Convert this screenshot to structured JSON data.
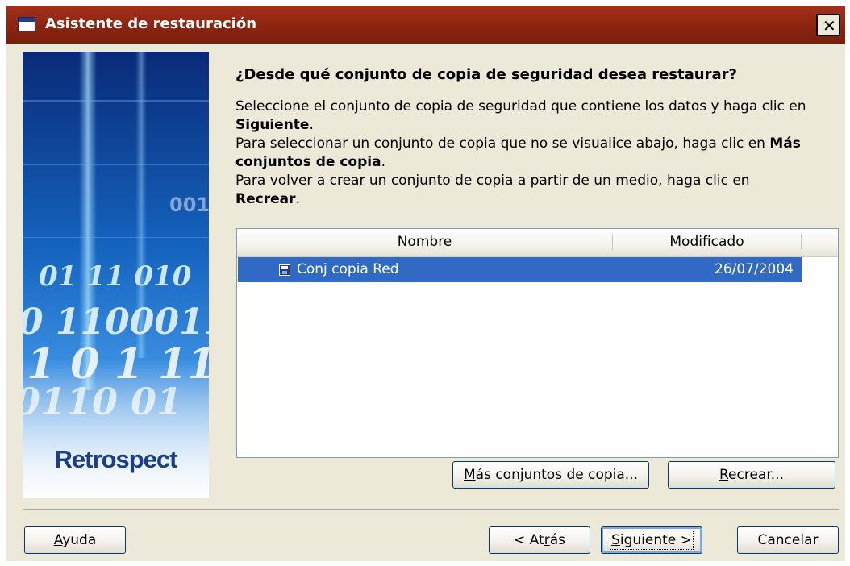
{
  "window": {
    "title": "Asistente de restauración",
    "close_symbol": "✕",
    "app_icon": "window-icon"
  },
  "side_panel": {
    "logo_text": "Retrospect",
    "image_description_icon": "binary-digits-image"
  },
  "content": {
    "heading": "¿Desde qué conjunto de copia de seguridad desea restaurar?",
    "p1_line1": "Seleccione el conjunto de copia de seguridad que contiene los datos y haga clic en",
    "p1_bold": "Siguiente",
    "p1_end": ".",
    "p2_line1_normal": "Para seleccionar un conjunto de copia que no se visualice abajo, haga clic en ",
    "p2_line1_bold": "Más",
    "p2_line2_bold": "conjuntos de copia",
    "p2_end": ".",
    "p3_line1": "Para volver a crear un conjunto de copia a partir de un medio, haga clic en",
    "p3_bold": "Recrear",
    "p3_end": "."
  },
  "list": {
    "columns": [
      "Nombre",
      "Modificado"
    ],
    "rows": [
      {
        "name": "Conj copia Red",
        "modified": "26/07/2004",
        "selected": true,
        "icon": "disk-icon"
      }
    ]
  },
  "buttons": {
    "more_sets": {
      "pre": "",
      "accel": "M",
      "post": "ás conjuntos de copia..."
    },
    "recreate": {
      "pre": "",
      "accel": "R",
      "post": "ecrear..."
    },
    "help": {
      "pre": "",
      "accel": "A",
      "post": "yuda"
    },
    "back": {
      "pre": "< At",
      "accel": "r",
      "post": "ás"
    },
    "next": {
      "pre": "",
      "accel": "S",
      "post": "iguiente >"
    },
    "cancel": {
      "pre": "Cancelar",
      "accel": "",
      "post": ""
    }
  },
  "colors": {
    "titlebar": "#8a2410",
    "selection": "#316ac5",
    "dialog_bg": "#ece9d8",
    "logo": "#1a3f8a"
  }
}
